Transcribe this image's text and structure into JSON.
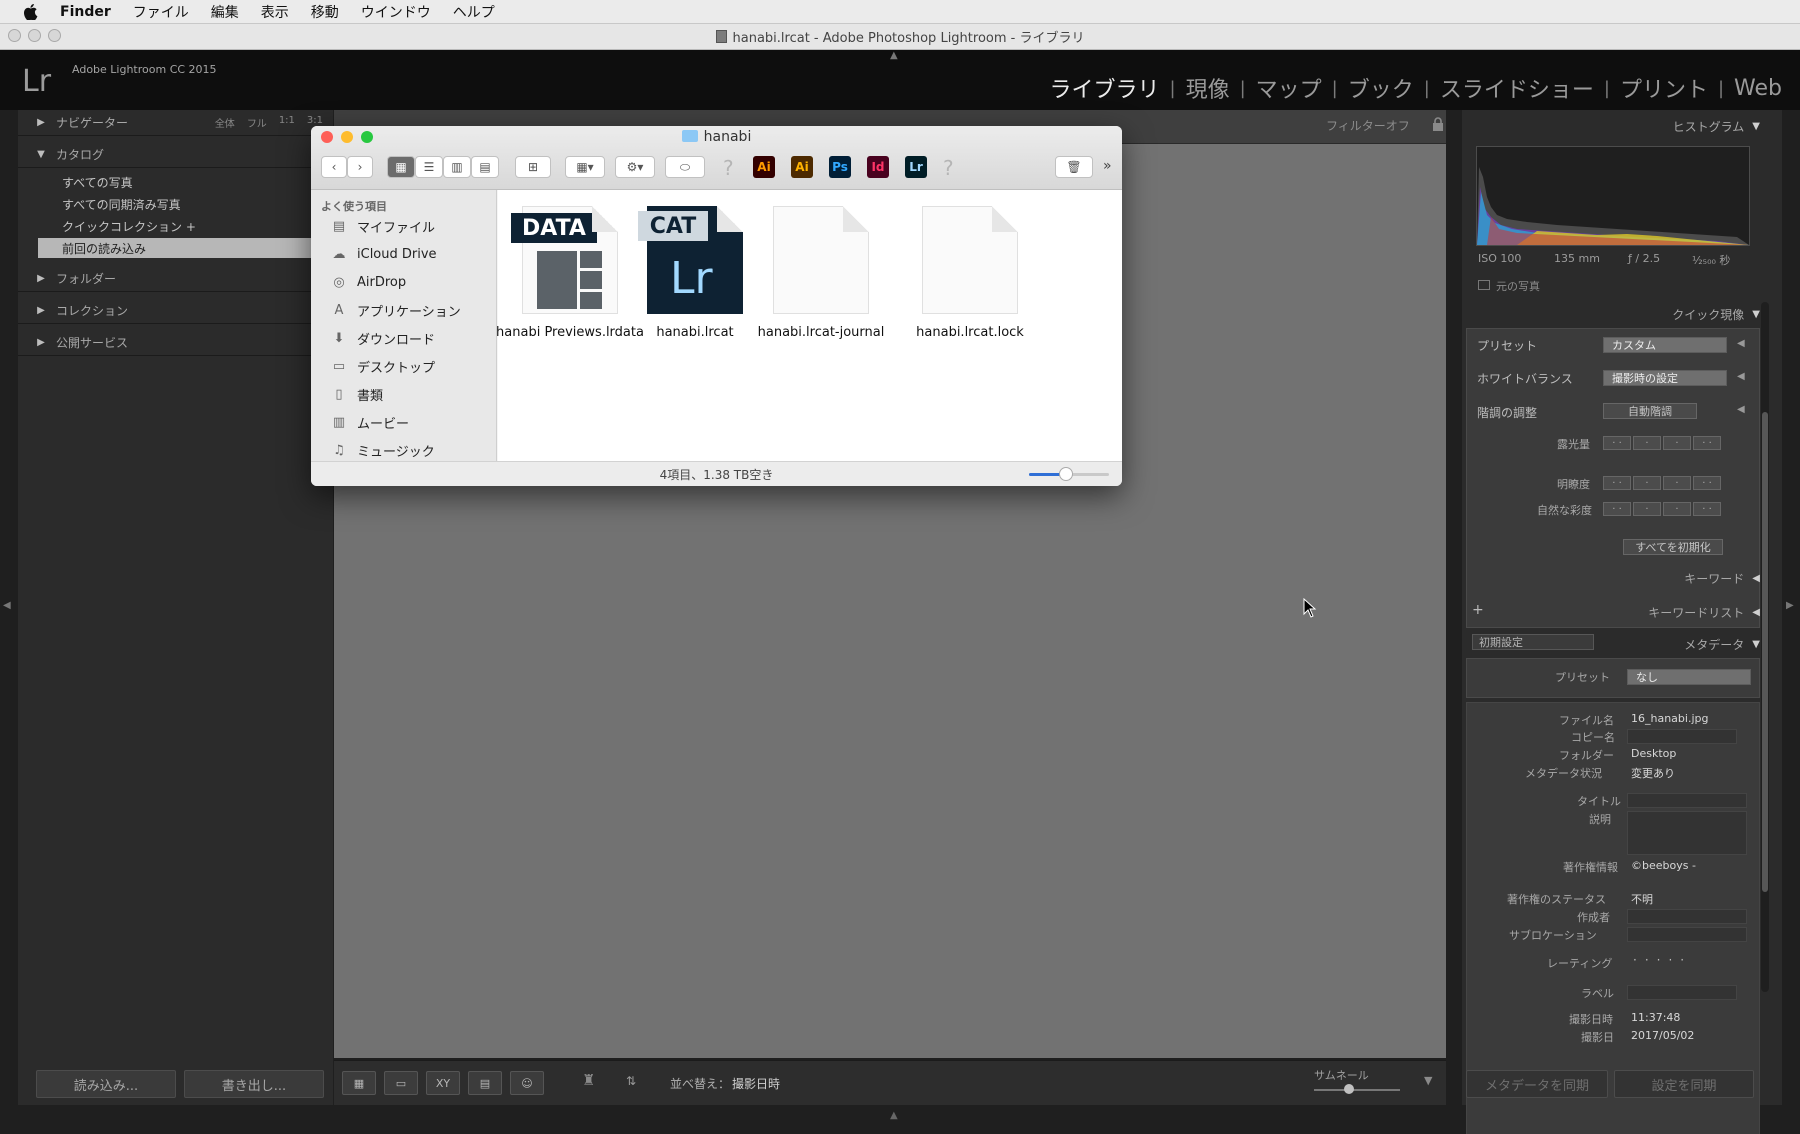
{
  "menubar": {
    "app": "Finder",
    "items": [
      "ファイル",
      "編集",
      "表示",
      "移動",
      "ウインドウ",
      "ヘルプ"
    ]
  },
  "window": {
    "title": "hanabi.lrcat - Adobe Photoshop Lightroom - ライブラリ"
  },
  "lightroom": {
    "logo": "Lr",
    "version": "Adobe Lightroom CC 2015",
    "modules": [
      "ライブラリ",
      "現像",
      "マップ",
      "ブック",
      "スライドショー",
      "プリント",
      "Web"
    ],
    "active_module": "ライブラリ"
  },
  "left_panel": {
    "navigator": {
      "title": "ナビゲーター",
      "zoom": [
        "全体",
        "フル",
        "1:1",
        "3:1"
      ]
    },
    "catalog": {
      "title": "カタログ",
      "items": [
        "すべての写真",
        "すべての同期済み写真",
        "クイックコレクション +",
        "前回の読み込み"
      ],
      "selected": "前回の読み込み"
    },
    "folders": "フォルダー",
    "collections": "コレクション",
    "publish_services": "公開サービス",
    "import_button": "読み込み...",
    "export_button": "書き出し..."
  },
  "center": {
    "filter": "フィルターオフ",
    "sort_label": "並べ替え：",
    "sort_value": "撮影日時",
    "thumbnail_label": "サムネール"
  },
  "right_panel": {
    "histogram": {
      "title": "ヒストグラム",
      "iso": "ISO 100",
      "focal": "135 mm",
      "aperture": "ƒ / 2.5",
      "shutter": "¹⁄₂₅₀₀ 秒",
      "original_photo": "元の写真"
    },
    "quick_develop": {
      "title": "クイック現像",
      "preset_label": "プリセット",
      "preset_value": "カスタム",
      "white_balance_label": "ホワイトバランス",
      "white_balance_value": "撮影時の設定",
      "tone_label": "階調の調整",
      "auto_tone": "自動階調",
      "exposure": "露光量",
      "clarity": "明瞭度",
      "vibrance": "自然な彩度",
      "reset_all": "すべてを初期化"
    },
    "keywords": {
      "title": "キーワード",
      "list_title": "キーワードリスト"
    },
    "metadata": {
      "title": "メタデータ",
      "default_select": "初期設定",
      "preset_label": "プリセット",
      "preset_value": "なし",
      "filename_label": "ファイル名",
      "filename_value": "16_hanabi.jpg",
      "copy_name_label": "コピー名",
      "folder_label": "フォルダー",
      "folder_value": "Desktop",
      "metadata_status_label": "メタデータ状況",
      "metadata_status_value": "変更あり",
      "title_label": "タイトル",
      "caption_label": "説明",
      "copyright_label": "著作権情報",
      "copyright_value": "©beeboys -",
      "copyright_status_label": "著作権のステータス",
      "copyright_status_value": "不明",
      "creator_label": "作成者",
      "sublocation_label": "サブロケーション",
      "rating_label": "レーティング",
      "label_label": "ラベル",
      "capture_time_label": "撮影日時",
      "capture_time_value": "11:37:48",
      "capture_date_label": "撮影日",
      "capture_date_value": "2017/05/02"
    },
    "sync_metadata": "メタデータを同期",
    "sync_settings": "設定を同期"
  },
  "finder": {
    "title": "hanabi",
    "sidebar_title": "よく使う項目",
    "sidebar_items": [
      {
        "label": "マイファイル",
        "icon": "all-files-icon"
      },
      {
        "label": "iCloud Drive",
        "icon": "cloud-icon"
      },
      {
        "label": "AirDrop",
        "icon": "airdrop-icon"
      },
      {
        "label": "アプリケーション",
        "icon": "applications-icon"
      },
      {
        "label": "ダウンロード",
        "icon": "download-icon"
      },
      {
        "label": "デスクトップ",
        "icon": "desktop-icon"
      },
      {
        "label": "書類",
        "icon": "documents-icon"
      },
      {
        "label": "ムービー",
        "icon": "movies-icon"
      },
      {
        "label": "ミュージック",
        "icon": "music-icon"
      }
    ],
    "files": [
      {
        "name": "hanabi Previews.lrdata",
        "badge": "DATA"
      },
      {
        "name": "hanabi.lrcat",
        "badge": "CAT",
        "mark": "Lr"
      },
      {
        "name": "hanabi.lrcat-journal"
      },
      {
        "name": "hanabi.lrcat.lock"
      }
    ],
    "toolbar_apps": [
      "Ai",
      "Ai",
      "Ps",
      "Id",
      "Lr"
    ],
    "status": "4項目、1.38 TB空き",
    "colors": {
      "close": "#fe5f57",
      "minimize": "#febc2e",
      "zoom": "#28c840",
      "selection": "#2f6fd6"
    }
  }
}
